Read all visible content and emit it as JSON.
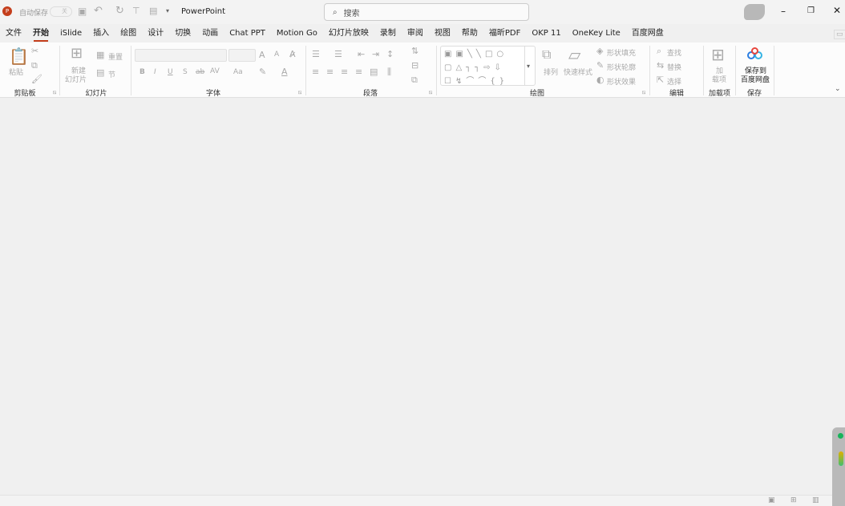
{
  "titlebar": {
    "autosave_label": "自动保存",
    "autosave_state": "关",
    "app_title": "PowerPoint",
    "search_placeholder": "搜索"
  },
  "tabs": [
    "文件",
    "开始",
    "iSlide",
    "插入",
    "绘图",
    "设计",
    "切换",
    "动画",
    "Chat PPT",
    "Motion Go",
    "幻灯片放映",
    "录制",
    "审阅",
    "视图",
    "帮助",
    "福昕PDF",
    "OKP 11",
    "OneKey Lite",
    "百度网盘"
  ],
  "active_tab": "开始",
  "ribbon": {
    "clipboard": {
      "label": "剪贴板",
      "paste": "粘贴"
    },
    "slides": {
      "label": "幻灯片",
      "new_slide_1": "新建",
      "new_slide_2": "幻灯片",
      "reset": "重置",
      "section": "节"
    },
    "font": {
      "label": "字体",
      "bold": "B",
      "italic": "I",
      "underline": "U",
      "strike": "S",
      "abc": "ab",
      "spacing": "AV",
      "case": "Aa",
      "grow": "A",
      "shrink": "A"
    },
    "paragraph": {
      "label": "段落"
    },
    "drawing": {
      "label": "绘图",
      "arrange": "排列",
      "quick_styles": "快速样式",
      "shape_fill": "形状填充",
      "shape_outline": "形状轮廓",
      "shape_effects": "形状效果"
    },
    "editing": {
      "label": "编辑",
      "find": "查找",
      "replace": "替换",
      "select": "选择"
    },
    "addins": {
      "label": "加载项",
      "btn1": "加",
      "btn2": "载项"
    },
    "save": {
      "label": "保存",
      "btn1": "保存到",
      "btn2": "百度网盘"
    }
  },
  "colors": {
    "accent": "#c43e1c",
    "ribbon_bg": "#fcfcfc",
    "canvas_bg": "#f0f0f0"
  }
}
